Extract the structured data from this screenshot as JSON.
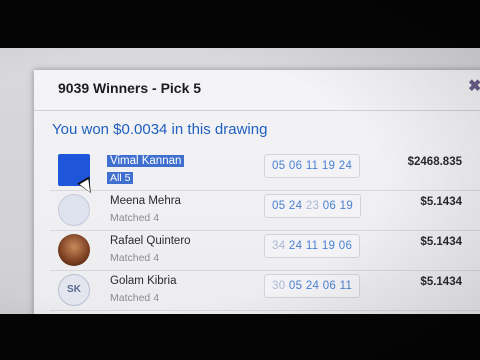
{
  "dialog": {
    "title": "9039 Winners - Pick 5",
    "close_icon": "close-icon",
    "summary": "You won $0.0034 in this drawing"
  },
  "winners": [
    {
      "name": "Vimal Kannan",
      "sub": "All 5",
      "picks": [
        "05",
        "06",
        "11",
        "19",
        "24"
      ],
      "hits": [
        true,
        true,
        true,
        true,
        true
      ],
      "amount": "$2468.835",
      "avatar": "square-blue",
      "selected": true
    },
    {
      "name": "Meena Mehra",
      "sub": "Matched 4",
      "picks": [
        "05",
        "24",
        "23",
        "06",
        "19"
      ],
      "hits": [
        true,
        true,
        false,
        true,
        true
      ],
      "amount": "$5.1434",
      "avatar": "default-avatar-icon"
    },
    {
      "name": "Rafael Quintero",
      "sub": "Matched 4",
      "picks": [
        "34",
        "24",
        "11",
        "19",
        "06"
      ],
      "hits": [
        false,
        true,
        true,
        true,
        true
      ],
      "amount": "$5.1434",
      "avatar": "photo"
    },
    {
      "name": "Golam Kibria",
      "sub": "Matched 4",
      "picks": [
        "30",
        "05",
        "24",
        "06",
        "11"
      ],
      "hits": [
        false,
        true,
        true,
        true,
        true
      ],
      "amount": "$5.1434",
      "avatar": "logo",
      "logo_text": "SK"
    }
  ],
  "colors": {
    "accent": "#1f5fbf",
    "selection": "#3f6fcf",
    "numbers": "#4a7fd2"
  }
}
